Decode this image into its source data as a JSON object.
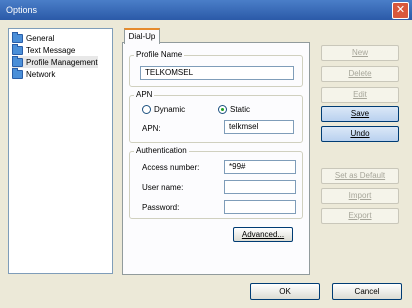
{
  "window": {
    "title": "Options"
  },
  "tree": {
    "items": [
      "General",
      "Text Message",
      "Profile Management",
      "Network"
    ]
  },
  "tab": {
    "label": "Dial-Up"
  },
  "profile": {
    "legend": "Profile Name",
    "value": "TELKOMSEL"
  },
  "apn": {
    "legend": "APN",
    "dynamic_label": "Dynamic",
    "static_label": "Static",
    "apn_label": "APN:",
    "apn_value": "telkmsel"
  },
  "auth": {
    "legend": "Authentication",
    "access_label": "Access number:",
    "access_value": "*99#",
    "user_label": "User name:",
    "user_value": "",
    "password_label": "Password:",
    "password_value": ""
  },
  "buttons": {
    "advanced": "Advanced...",
    "new": "New",
    "delete": "Delete",
    "edit": "Edit",
    "save": "Save",
    "undo": "Undo",
    "set_default": "Set as Default",
    "import": "Import",
    "export": "Export",
    "ok": "OK",
    "cancel": "Cancel"
  }
}
